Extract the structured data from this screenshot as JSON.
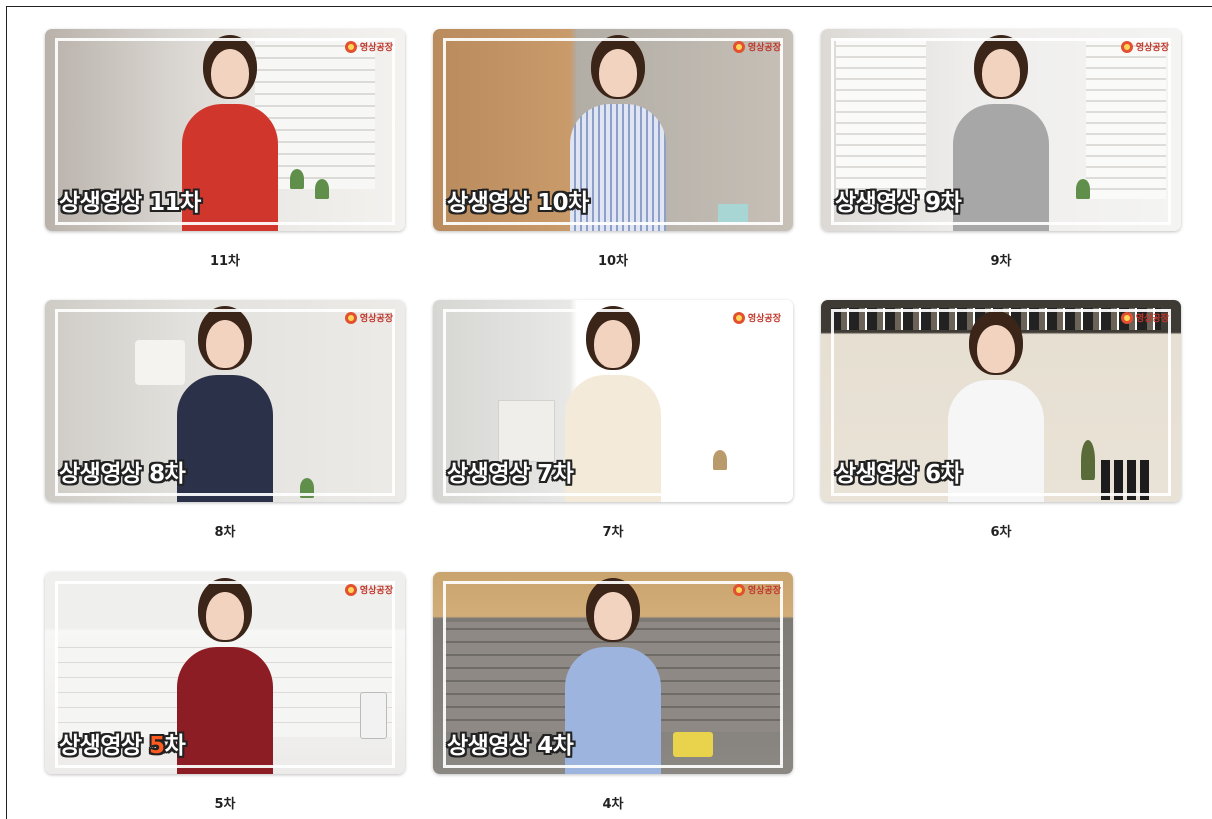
{
  "videos": [
    {
      "overlay_prefix": "상생영상 ",
      "overlay_number": "11차",
      "caption": "11차"
    },
    {
      "overlay_prefix": "상생영상 ",
      "overlay_number": "10차",
      "caption": "10차"
    },
    {
      "overlay_prefix": "상생영상 ",
      "overlay_number": "9차",
      "caption": "9차"
    },
    {
      "overlay_prefix": "상생영상 ",
      "overlay_number": "8차",
      "caption": "8차"
    },
    {
      "overlay_prefix": "상생영상 ",
      "overlay_number": "7차",
      "caption": "7차"
    },
    {
      "overlay_prefix": "상생영상 ",
      "overlay_number": "6차",
      "caption": "6차"
    },
    {
      "overlay_prefix": "상생영상 ",
      "overlay_number": "5",
      "overlay_suffix": "차",
      "caption": "5차"
    },
    {
      "overlay_prefix": "상생영상 ",
      "overlay_number": "4차",
      "caption": "4차"
    }
  ],
  "logo_text": "영상공장",
  "colors": {
    "accent_number": "#ff5a1f",
    "logo": "#e2502f"
  }
}
